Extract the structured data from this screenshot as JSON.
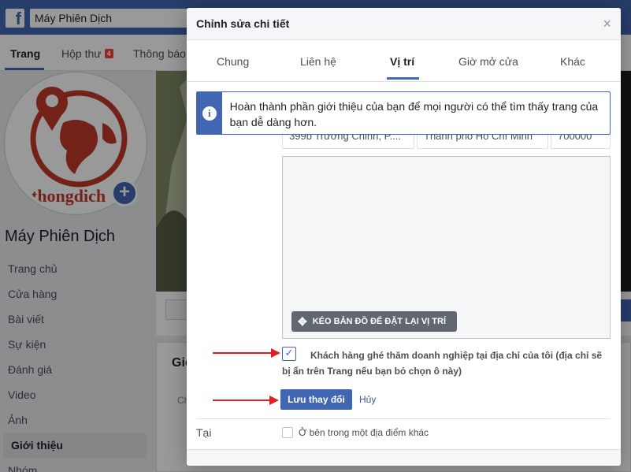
{
  "topbar": {
    "logo": "f",
    "search_value": "Máy Phiên Dịch"
  },
  "page_tabs": {
    "items": [
      "Trang",
      "Hộp thư",
      "Thông báo"
    ],
    "inbox_badge": "4"
  },
  "sidebar": {
    "page_name": "Máy Phiên Dịch",
    "avatar_text": "thongdich",
    "items": [
      "Trang chủ",
      "Cửa hàng",
      "Bài viết",
      "Sự kiện",
      "Đánh giá",
      "Video",
      "Ảnh",
      "Giới thiệu",
      "Nhóm"
    ]
  },
  "about_card": {
    "title": "Giớ",
    "sub": "Ch"
  },
  "dialog": {
    "title": "Chỉnh sửa chi tiết",
    "close": "×",
    "tabs": [
      "Chung",
      "Liên hệ",
      "Vị trí",
      "Giờ mở cửa",
      "Khác"
    ],
    "active_tab": "Vị trí",
    "info_text": "Hoàn thành phần giới thiệu của bạn để mọi người có thể tìm thấy trang của bạn dễ dàng hơn.",
    "address": {
      "street": "399b Trường Chinh, P....",
      "city": "Thành phố Hồ Chí Minh",
      "zip": "700000"
    },
    "map_button": "KÉO BẢN ĐỒ ĐỂ ĐẶT LẠI VỊ TRÍ",
    "visit_checkbox_label": "Khách hàng ghé thăm doanh nghiệp tại địa chỉ của tôi (địa chỉ sẽ bị ẩn trên Trang nếu bạn bỏ chọn ô này)",
    "visit_checked": true,
    "save_label": "Lưu thay đổi",
    "cancel_label": "Hủy",
    "location_label": "Tại",
    "inside_other_label": "Ở bên trong một địa điểm khác"
  },
  "colors": {
    "brand": "#4267b2",
    "arrow": "#e02020"
  }
}
